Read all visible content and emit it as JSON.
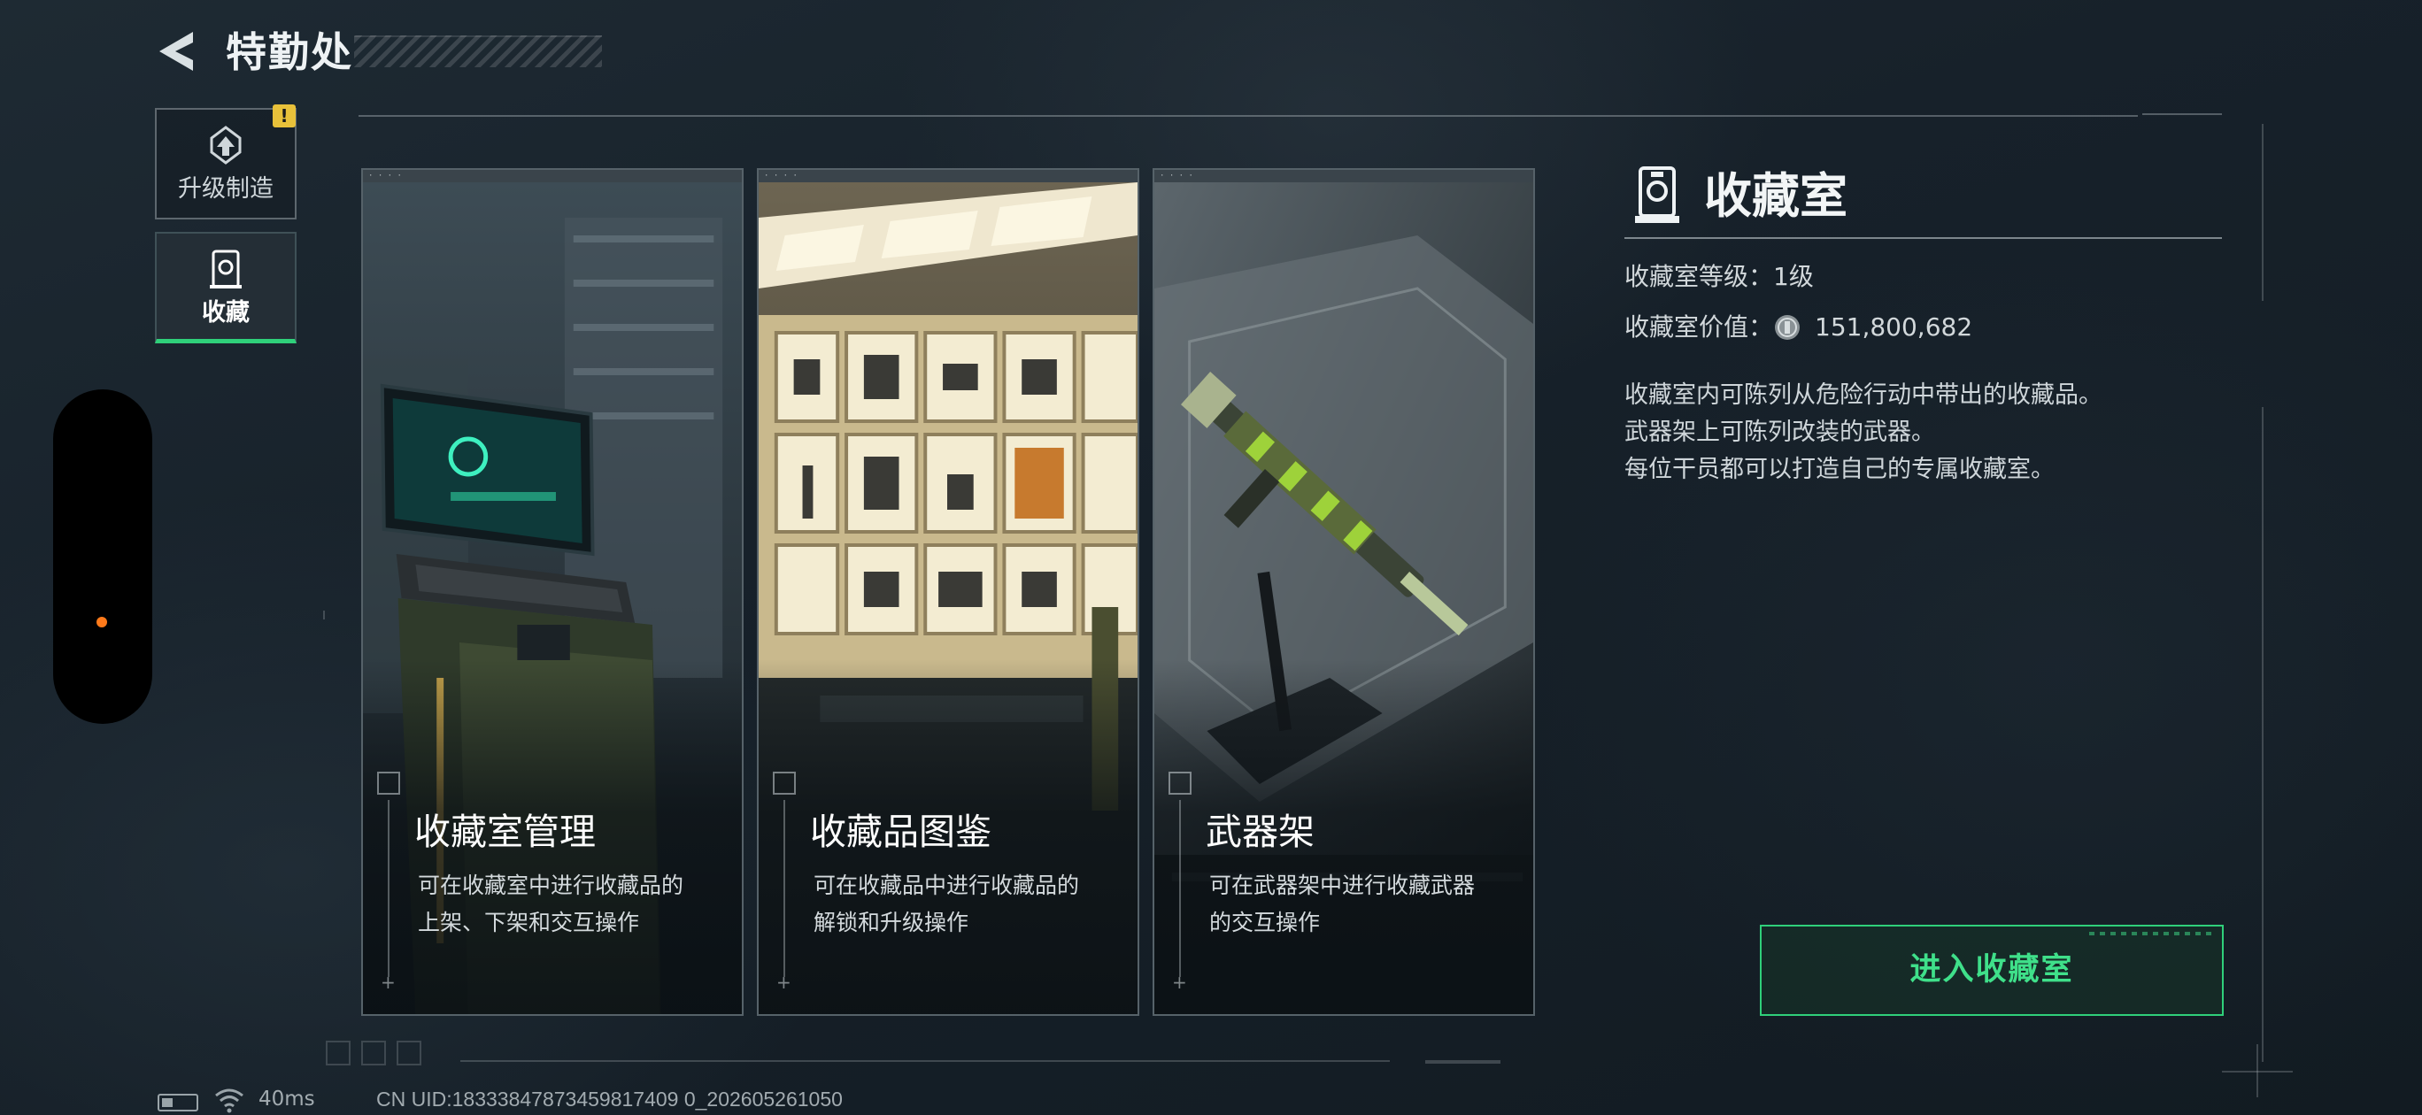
{
  "header": {
    "title": "特勤处"
  },
  "sidebar": {
    "items": [
      {
        "label": "升级制造",
        "icon": "upgrade-icon",
        "badge": "!"
      },
      {
        "label": "收藏",
        "icon": "collection-icon",
        "selected": true
      }
    ]
  },
  "cards": [
    {
      "title": "收藏室管理",
      "desc_line1": "可在收藏室中进行收藏品的",
      "desc_line2": "上架、下架和交互操作"
    },
    {
      "title": "收藏品图鉴",
      "desc_line1": "可在收藏品中进行收藏品的",
      "desc_line2": "解锁和升级操作"
    },
    {
      "title": "武器架",
      "desc_line1": "可在武器架中进行收藏武器",
      "desc_line2": "的交互操作"
    }
  ],
  "info": {
    "title": "收藏室",
    "level": "收藏室等级：1级",
    "value_label": "收藏室价值：",
    "value": "151,800,682",
    "desc": [
      "收藏室内可陈列从危险行动中带出的收藏品。",
      "武器架上可陈列改装的武器。",
      "每位干员都可以打造自己的专属收藏室。"
    ],
    "enter_button": "进入收藏室"
  },
  "status_bar": {
    "ping": "40ms",
    "uid": "CN UID:18333847873459817409 0_202605261050"
  },
  "colors": {
    "accent": "#2fd07a",
    "badge": "#e8c13a",
    "dot": "#ff7a1a"
  }
}
